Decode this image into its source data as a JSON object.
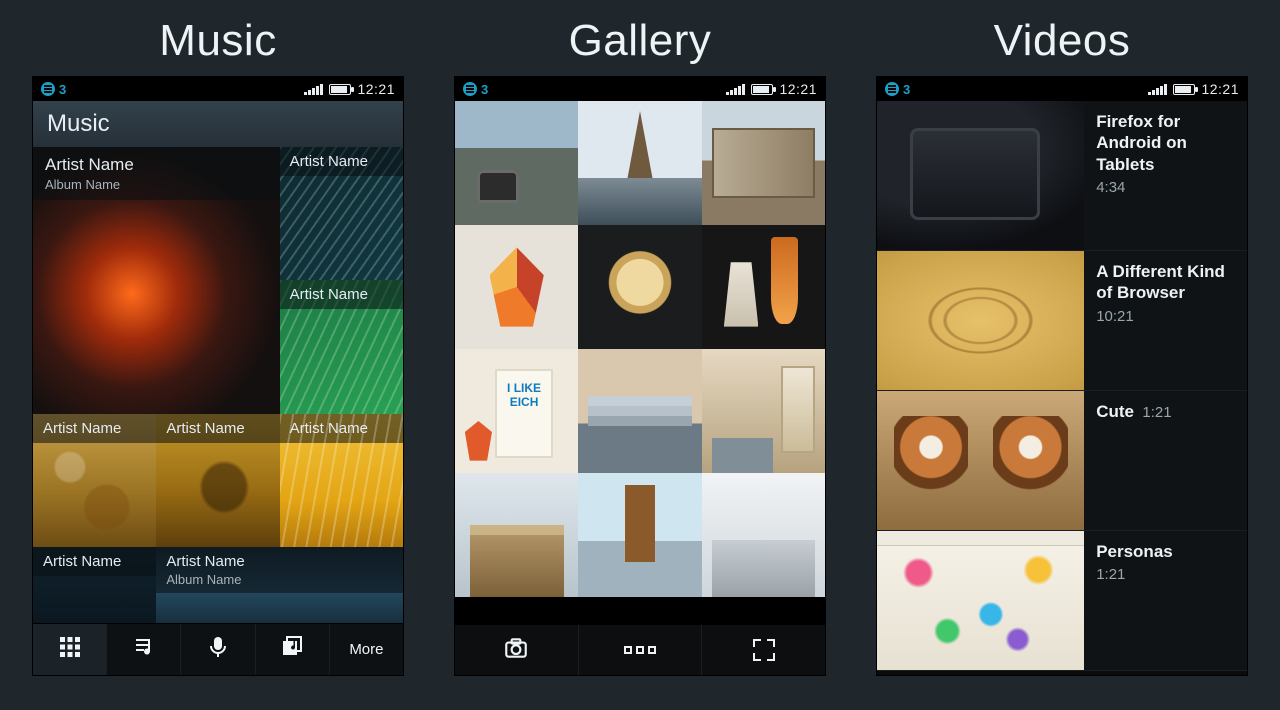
{
  "columns": {
    "music": "Music",
    "gallery": "Gallery",
    "videos": "Videos"
  },
  "status": {
    "indicator": "3",
    "time": "12:21"
  },
  "music": {
    "header": "Music",
    "tiles": {
      "big": {
        "artist": "Artist Name",
        "album": "Album Name"
      },
      "r0": {
        "artist": "Artist Name"
      },
      "r1": {
        "artist": "Artist Name"
      },
      "b0": {
        "artist": "Artist Name"
      },
      "b1": {
        "artist": "Artist Name"
      },
      "b2": {
        "artist": "Artist Name"
      },
      "c0": {
        "artist": "Artist Name"
      },
      "c1": {
        "artist": "Artist Name",
        "album": "Album Name"
      }
    },
    "tabs": {
      "more": "More"
    }
  },
  "videos": {
    "items": [
      {
        "title": "Firefox for Android on Tablets",
        "duration": "4:34"
      },
      {
        "title": "A Different Kind of Browser",
        "duration": "10:21"
      },
      {
        "title": "Cute",
        "duration": "1:21"
      },
      {
        "title": "Personas",
        "duration": "1:21"
      }
    ]
  }
}
